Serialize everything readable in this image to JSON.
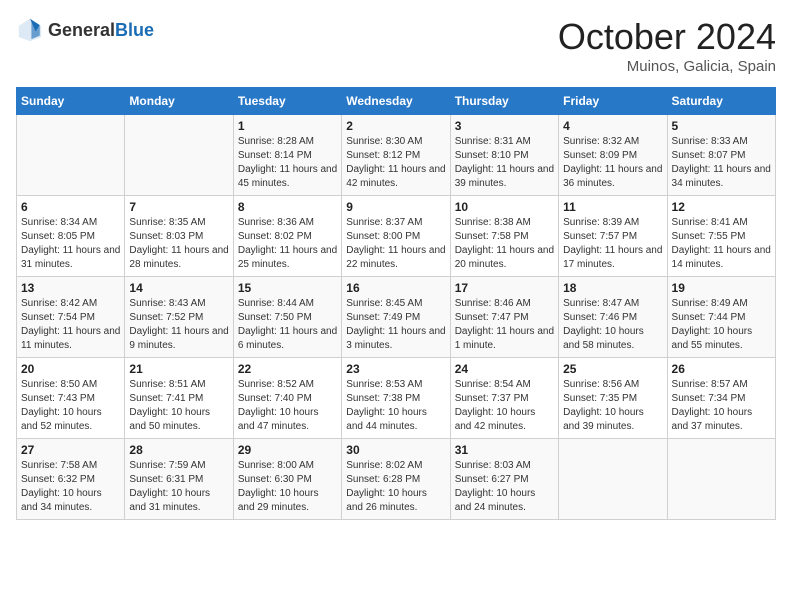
{
  "header": {
    "logo_general": "General",
    "logo_blue": "Blue",
    "month": "October 2024",
    "location": "Muinos, Galicia, Spain"
  },
  "weekdays": [
    "Sunday",
    "Monday",
    "Tuesday",
    "Wednesday",
    "Thursday",
    "Friday",
    "Saturday"
  ],
  "weeks": [
    [
      {
        "day": "",
        "detail": ""
      },
      {
        "day": "",
        "detail": ""
      },
      {
        "day": "1",
        "detail": "Sunrise: 8:28 AM\nSunset: 8:14 PM\nDaylight: 11 hours and 45 minutes."
      },
      {
        "day": "2",
        "detail": "Sunrise: 8:30 AM\nSunset: 8:12 PM\nDaylight: 11 hours and 42 minutes."
      },
      {
        "day": "3",
        "detail": "Sunrise: 8:31 AM\nSunset: 8:10 PM\nDaylight: 11 hours and 39 minutes."
      },
      {
        "day": "4",
        "detail": "Sunrise: 8:32 AM\nSunset: 8:09 PM\nDaylight: 11 hours and 36 minutes."
      },
      {
        "day": "5",
        "detail": "Sunrise: 8:33 AM\nSunset: 8:07 PM\nDaylight: 11 hours and 34 minutes."
      }
    ],
    [
      {
        "day": "6",
        "detail": "Sunrise: 8:34 AM\nSunset: 8:05 PM\nDaylight: 11 hours and 31 minutes."
      },
      {
        "day": "7",
        "detail": "Sunrise: 8:35 AM\nSunset: 8:03 PM\nDaylight: 11 hours and 28 minutes."
      },
      {
        "day": "8",
        "detail": "Sunrise: 8:36 AM\nSunset: 8:02 PM\nDaylight: 11 hours and 25 minutes."
      },
      {
        "day": "9",
        "detail": "Sunrise: 8:37 AM\nSunset: 8:00 PM\nDaylight: 11 hours and 22 minutes."
      },
      {
        "day": "10",
        "detail": "Sunrise: 8:38 AM\nSunset: 7:58 PM\nDaylight: 11 hours and 20 minutes."
      },
      {
        "day": "11",
        "detail": "Sunrise: 8:39 AM\nSunset: 7:57 PM\nDaylight: 11 hours and 17 minutes."
      },
      {
        "day": "12",
        "detail": "Sunrise: 8:41 AM\nSunset: 7:55 PM\nDaylight: 11 hours and 14 minutes."
      }
    ],
    [
      {
        "day": "13",
        "detail": "Sunrise: 8:42 AM\nSunset: 7:54 PM\nDaylight: 11 hours and 11 minutes."
      },
      {
        "day": "14",
        "detail": "Sunrise: 8:43 AM\nSunset: 7:52 PM\nDaylight: 11 hours and 9 minutes."
      },
      {
        "day": "15",
        "detail": "Sunrise: 8:44 AM\nSunset: 7:50 PM\nDaylight: 11 hours and 6 minutes."
      },
      {
        "day": "16",
        "detail": "Sunrise: 8:45 AM\nSunset: 7:49 PM\nDaylight: 11 hours and 3 minutes."
      },
      {
        "day": "17",
        "detail": "Sunrise: 8:46 AM\nSunset: 7:47 PM\nDaylight: 11 hours and 1 minute."
      },
      {
        "day": "18",
        "detail": "Sunrise: 8:47 AM\nSunset: 7:46 PM\nDaylight: 10 hours and 58 minutes."
      },
      {
        "day": "19",
        "detail": "Sunrise: 8:49 AM\nSunset: 7:44 PM\nDaylight: 10 hours and 55 minutes."
      }
    ],
    [
      {
        "day": "20",
        "detail": "Sunrise: 8:50 AM\nSunset: 7:43 PM\nDaylight: 10 hours and 52 minutes."
      },
      {
        "day": "21",
        "detail": "Sunrise: 8:51 AM\nSunset: 7:41 PM\nDaylight: 10 hours and 50 minutes."
      },
      {
        "day": "22",
        "detail": "Sunrise: 8:52 AM\nSunset: 7:40 PM\nDaylight: 10 hours and 47 minutes."
      },
      {
        "day": "23",
        "detail": "Sunrise: 8:53 AM\nSunset: 7:38 PM\nDaylight: 10 hours and 44 minutes."
      },
      {
        "day": "24",
        "detail": "Sunrise: 8:54 AM\nSunset: 7:37 PM\nDaylight: 10 hours and 42 minutes."
      },
      {
        "day": "25",
        "detail": "Sunrise: 8:56 AM\nSunset: 7:35 PM\nDaylight: 10 hours and 39 minutes."
      },
      {
        "day": "26",
        "detail": "Sunrise: 8:57 AM\nSunset: 7:34 PM\nDaylight: 10 hours and 37 minutes."
      }
    ],
    [
      {
        "day": "27",
        "detail": "Sunrise: 7:58 AM\nSunset: 6:32 PM\nDaylight: 10 hours and 34 minutes."
      },
      {
        "day": "28",
        "detail": "Sunrise: 7:59 AM\nSunset: 6:31 PM\nDaylight: 10 hours and 31 minutes."
      },
      {
        "day": "29",
        "detail": "Sunrise: 8:00 AM\nSunset: 6:30 PM\nDaylight: 10 hours and 29 minutes."
      },
      {
        "day": "30",
        "detail": "Sunrise: 8:02 AM\nSunset: 6:28 PM\nDaylight: 10 hours and 26 minutes."
      },
      {
        "day": "31",
        "detail": "Sunrise: 8:03 AM\nSunset: 6:27 PM\nDaylight: 10 hours and 24 minutes."
      },
      {
        "day": "",
        "detail": ""
      },
      {
        "day": "",
        "detail": ""
      }
    ]
  ]
}
